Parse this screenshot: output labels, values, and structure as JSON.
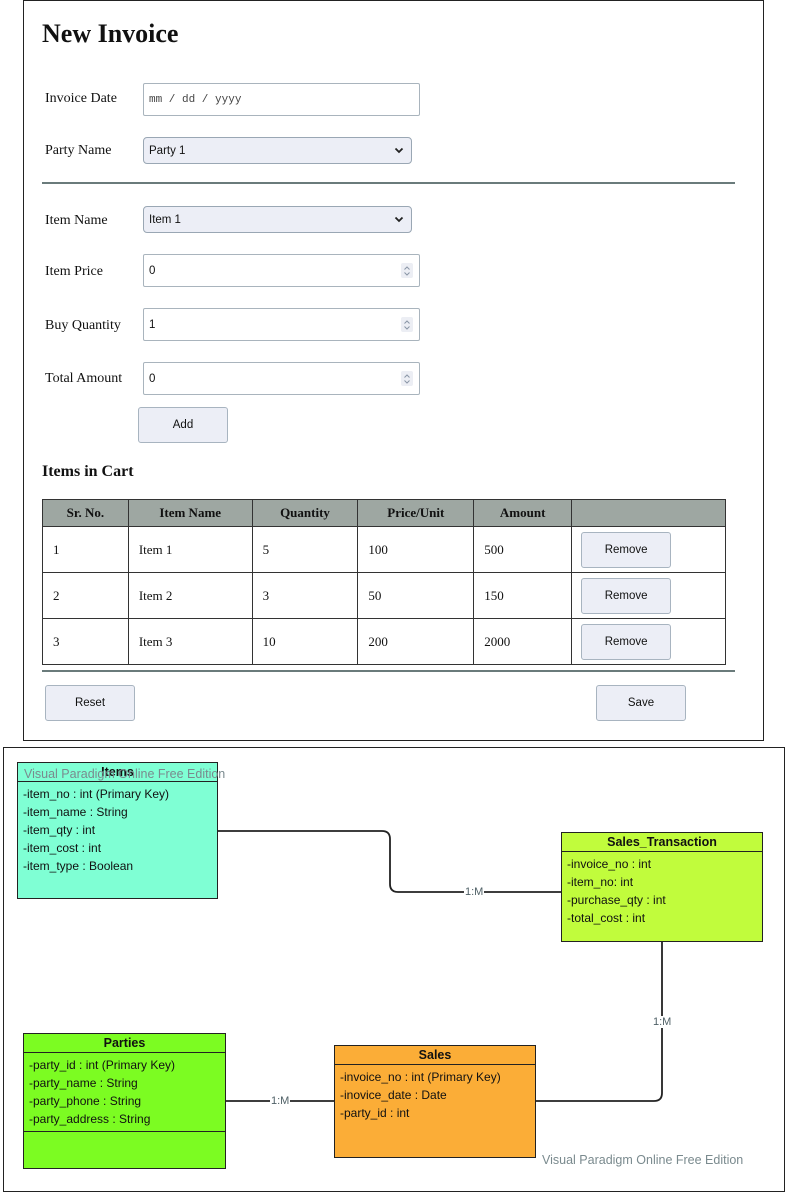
{
  "form": {
    "title": "New Invoice",
    "invoice_date": {
      "label": "Invoice Date",
      "placeholder": "mm / dd / yyyy",
      "value": ""
    },
    "party_name": {
      "label": "Party Name",
      "selected": "Party 1"
    },
    "item_name": {
      "label": "Item Name",
      "selected": "Item 1"
    },
    "item_price": {
      "label": "Item Price",
      "value": "0"
    },
    "buy_quantity": {
      "label": "Buy Quantity",
      "value": "1"
    },
    "total_amount": {
      "label": "Total Amount",
      "value": "0"
    },
    "add_label": "Add",
    "icons": {
      "select": "chevron-down-icon",
      "spinner": "spinner-updown-icon"
    }
  },
  "cart": {
    "title": "Items in Cart",
    "columns": [
      "Sr. No.",
      "Item Name",
      "Quantity",
      "Price/Unit",
      "Amount",
      ""
    ],
    "rows": [
      {
        "sr": "1",
        "item": "Item 1",
        "qty": "5",
        "price": "100",
        "amount": "500",
        "action": "Remove"
      },
      {
        "sr": "2",
        "item": "Item 2",
        "qty": "3",
        "price": "50",
        "amount": "150",
        "action": "Remove"
      },
      {
        "sr": "3",
        "item": "Item 3",
        "qty": "10",
        "price": "200",
        "amount": "2000",
        "action": "Remove"
      }
    ]
  },
  "footer": {
    "reset_label": "Reset",
    "save_label": "Save"
  },
  "diagram": {
    "watermark": "Visual Paradigm Online Free Edition",
    "entities": {
      "items": {
        "name": "Items",
        "color": "#7fffd4",
        "attributes": [
          "-item_no : int (Primary Key)",
          "-item_name : String",
          "-item_qty : int",
          "-item_cost : int",
          "-item_type : Boolean"
        ]
      },
      "sales_transaction": {
        "name": "Sales_Transaction",
        "color": "#c1fc3c",
        "attributes": [
          "-invoice_no : int",
          "-item_no: int",
          "-purchase_qty : int",
          "-total_cost : int"
        ]
      },
      "parties": {
        "name": "Parties",
        "color": "#7cfc22",
        "attributes": [
          "-party_id : int (Primary Key)",
          "-party_name : String",
          "-party_phone : String",
          "-party_address : String"
        ]
      },
      "sales": {
        "name": "Sales",
        "color": "#fbad37",
        "attributes": [
          "-invoice_no : int (Primary Key)",
          "-inovice_date : Date",
          "-party_id : int"
        ]
      }
    },
    "relations": [
      {
        "from": "Items",
        "to": "Sales_Transaction",
        "label": "1:M"
      },
      {
        "from": "Sales_Transaction",
        "to": "Sales",
        "label": "1:M"
      },
      {
        "from": "Parties",
        "to": "Sales",
        "label": "1:M"
      }
    ]
  }
}
